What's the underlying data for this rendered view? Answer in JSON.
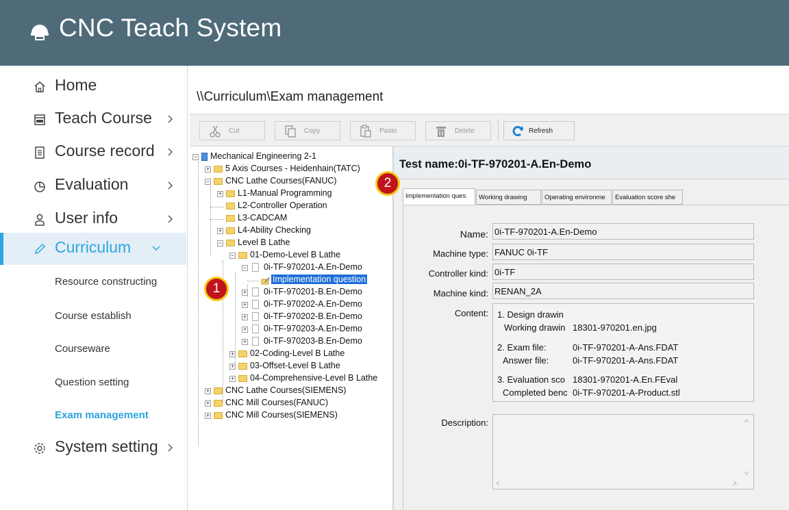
{
  "app": {
    "title": "CNC Teach System"
  },
  "sidebar": {
    "items": [
      {
        "label": "Home",
        "icon": "home-icon"
      },
      {
        "label": "Teach Course",
        "icon": "cnc-book-icon"
      },
      {
        "label": "Course record",
        "icon": "document-icon"
      },
      {
        "label": "Evaluation",
        "icon": "pie-chart-icon"
      },
      {
        "label": "User info",
        "icon": "user-icon"
      },
      {
        "label": "Curriculum",
        "icon": "pencil-icon"
      },
      {
        "label": "System setting",
        "icon": "gear-icon"
      }
    ],
    "subitems": [
      "Resource constructing",
      "Course establish",
      "Courseware",
      "Question setting",
      "Exam management"
    ],
    "active_item": "Curriculum",
    "active_subitem": "Exam management",
    "accent_color": "#2ea7de"
  },
  "breadcrumb": "\\\\Curriculum\\Exam management",
  "toolbar": {
    "cut": "Cut",
    "copy": "Copy",
    "paste": "Paste",
    "delete": "Delete",
    "refresh": "Refresh"
  },
  "tree": {
    "root": "Mechanical Engineering 2-1",
    "n1": "5 Axis Courses - Heidenhain(TATC)",
    "n2": "CNC Lathe Courses(FANUC)",
    "n3": "L1-Manual Programming",
    "n4": "L2-Controller Operation",
    "n5": "L3-CADCAM",
    "n6": "L4-Ability Checking",
    "n7": "Level B Lathe",
    "n8": "01-Demo-Level B Lathe",
    "n9": "0i-TF-970201-A.En-Demo",
    "n10": "Implementation question",
    "n11": "0i-TF-970201-B.En-Demo",
    "n12": "0i-TF-970202-A.En-Demo",
    "n13": "0i-TF-970202-B.En-Demo",
    "n14": "0i-TF-970203-A.En-Demo",
    "n15": "0i-TF-970203-B.En-Demo",
    "n16": "02-Coding-Level B Lathe",
    "n17": "03-Offset-Level B Lathe",
    "n18": "04-Comprehensive-Level B Lathe",
    "n19": "CNC Lathe Courses(SIEMENS)",
    "n20": "CNC Mill Courses(FANUC)",
    "n21": "CNC Mill Courses(SIEMENS)"
  },
  "detail": {
    "test_name": "Test name:0i-TF-970201-A.En-Demo",
    "tabs": [
      "Implementation ques",
      "Working drawing",
      "Operating environme",
      "Evaluation score she"
    ],
    "labels": {
      "name": "Name:",
      "machine_type": "Machine type:",
      "controller_kind": "Controller kind:",
      "machine_kind": "Machine kind:",
      "content": "Content:",
      "description": "Description:"
    },
    "values": {
      "name": "0i-TF-970201-A.En-Demo",
      "machine_type": "FANUC 0i-TF",
      "controller_kind": "0i-TF",
      "machine_kind": "RENAN_2A"
    },
    "content": {
      "l1": "1. Design drawin",
      "l2k": "Working drawin",
      "l2v": "18301-970201.en.jpg",
      "l3k": "2. Exam file:",
      "l3v": "0i-TF-970201-A-Ans.FDAT",
      "l4k": "Answer file:",
      "l4v": "0i-TF-970201-A-Ans.FDAT",
      "l5k": "3. Evaluation sco",
      "l5v": "18301-970201-A.En.FEval",
      "l6k": "Completed benc",
      "l6v": "0i-TF-970201-A-Product.stl"
    }
  },
  "badges": [
    "1",
    "2"
  ],
  "colors": {
    "header_bg": "#4f6b7a",
    "badge_fill": "#c0141a",
    "badge_ring": "#f4c816",
    "selection": "#1f6fd6"
  }
}
